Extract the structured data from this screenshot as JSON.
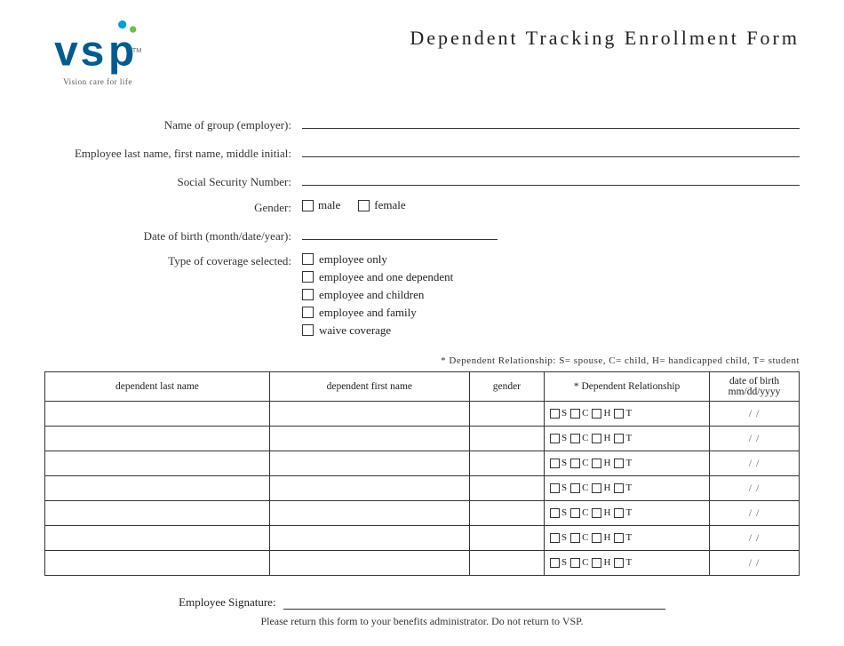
{
  "header": {
    "title": "Dependent Tracking Enrollment Form",
    "logo_tagline": "Vision care for life"
  },
  "fields": {
    "group_label": "Name of group (employer):",
    "employee_label": "Employee last name, first name, middle initial:",
    "ssn_label": "Social Security Number:",
    "gender_label": "Gender:",
    "dob_label": "Date of birth (month/date/year):",
    "coverage_label": "Type of coverage selected:"
  },
  "gender_options": [
    "male",
    "female"
  ],
  "coverage_options": [
    "employee only",
    "employee and one dependent",
    "employee and children",
    "employee and family",
    "waive coverage"
  ],
  "table": {
    "dependent_note": "* Dependent Relationship: S= spouse, C= child, H= handicapped child, T= student",
    "headers": [
      "dependent last name",
      "dependent first name",
      "gender",
      "* Dependent Relationship",
      "date of birth mm/dd/yyyy"
    ],
    "rows": 7,
    "rel_options": [
      "S",
      "C",
      "H",
      "T"
    ],
    "dob_placeholder": "/    /"
  },
  "footer": {
    "signature_label": "Employee Signature:",
    "return_note": "Please return this form to your benefits administrator. Do not return to VSP."
  }
}
